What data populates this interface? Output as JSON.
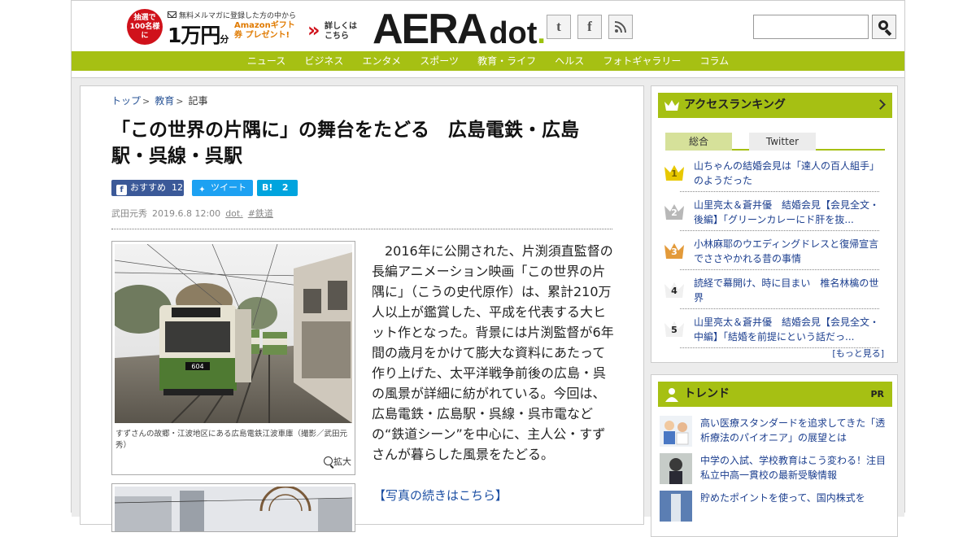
{
  "header": {
    "promo": {
      "badge": "抽選で 100名様に",
      "line1": "無料メルマガに登録した方の中から",
      "amount": "1万円",
      "amount_suffix": "分",
      "gift": "Amazonギフト券 プレゼント!",
      "more": "詳しくは こちら"
    },
    "logo_main": "AERA",
    "logo_sub": "dot",
    "logo_dot": ".",
    "social": [
      {
        "icon": "twitter-icon",
        "glyph": "t"
      },
      {
        "icon": "facebook-icon",
        "glyph": "f"
      },
      {
        "icon": "rss-icon",
        "glyph": "◟"
      }
    ],
    "search": {
      "placeholder": "",
      "value": ""
    }
  },
  "nav": {
    "items": [
      "ニュース",
      "ビジネス",
      "エンタメ",
      "スポーツ",
      "教育・ライフ",
      "ヘルス",
      "フォトギャラリー",
      "コラム"
    ]
  },
  "article": {
    "breadcrumb": [
      "トップ",
      "教育",
      "記事"
    ],
    "title": "「この世界の片隅に」の舞台をたどる　広島電鉄・広島駅・呉線・呉駅",
    "share": {
      "fb_label": "おすすめ",
      "fb_count": "12",
      "tw_label": "ツイート",
      "hb_label": "B!",
      "hb_count": "2"
    },
    "author": "武田元秀",
    "date": "2019.6.8 12:00",
    "tag_site": "dot.",
    "tag_topic": "#鉄道",
    "caption": "すずさんの故郷・江波地区にある広島電鉄江波車庫（撮影／武田元秀）",
    "zoom": "拡大",
    "body": "2016年に公開された、片渕須直監督の長編アニメーション映画「この世界の片隅に」（こうの史代原作）は、累計210万人以上が鑑賞した、平成を代表する大ヒット作となった。背景には片渕監督が6年間の歳月をかけて膨大な資料にあたって作り上げた、太平洋戦争前後の広島・呉の風景が詳細に紡がれている。今回は、広島電鉄・広島駅・呉線・呉市電などの“鉄道シーン”を中心に、主人公・すずさんが暮らした風景をたどる。",
    "photo_more": "【写真の続きはこちら】",
    "tram_number": "604"
  },
  "ranking": {
    "heading": "アクセスランキング",
    "tabs": [
      "総合",
      "Twitter"
    ],
    "items": [
      {
        "rank": "1",
        "text": "山ちゃんの結婚会見は「達人の百人組手」のようだった"
      },
      {
        "rank": "2",
        "text": "山里亮太＆蒼井優　結婚会見【会見全文・後編】「グリーンカレーにド肝を抜..."
      },
      {
        "rank": "3",
        "text": "小林麻耶のウエディングドレスと復帰宣言でささやかれる昔の事情"
      },
      {
        "rank": "4",
        "text": "読経で幕開け、時に目まい　椎名林檎の世界"
      },
      {
        "rank": "5",
        "text": "山里亮太＆蒼井優　結婚会見【会見全文・中編】「結婚を前提にという話だっ..."
      }
    ],
    "more": "[もっと見る]"
  },
  "trend": {
    "heading": "トレンド",
    "pr": "PR",
    "items": [
      {
        "text": "高い医療スタンダードを追求してきた「透析療法のパイオニア」の展望とは"
      },
      {
        "text": "中学の入試、学校教育はこう変わる！注目私立中高一貫校の最新受験情報"
      },
      {
        "text": "貯めたポイントを使って、国内株式を"
      }
    ]
  },
  "colors": {
    "accent_green": "#a6c013",
    "link_blue": "#1c3f8f",
    "promo_red": "#d0121b",
    "facebook": "#3b5998",
    "twitter": "#1da1f2",
    "hatena": "#00a4de"
  }
}
